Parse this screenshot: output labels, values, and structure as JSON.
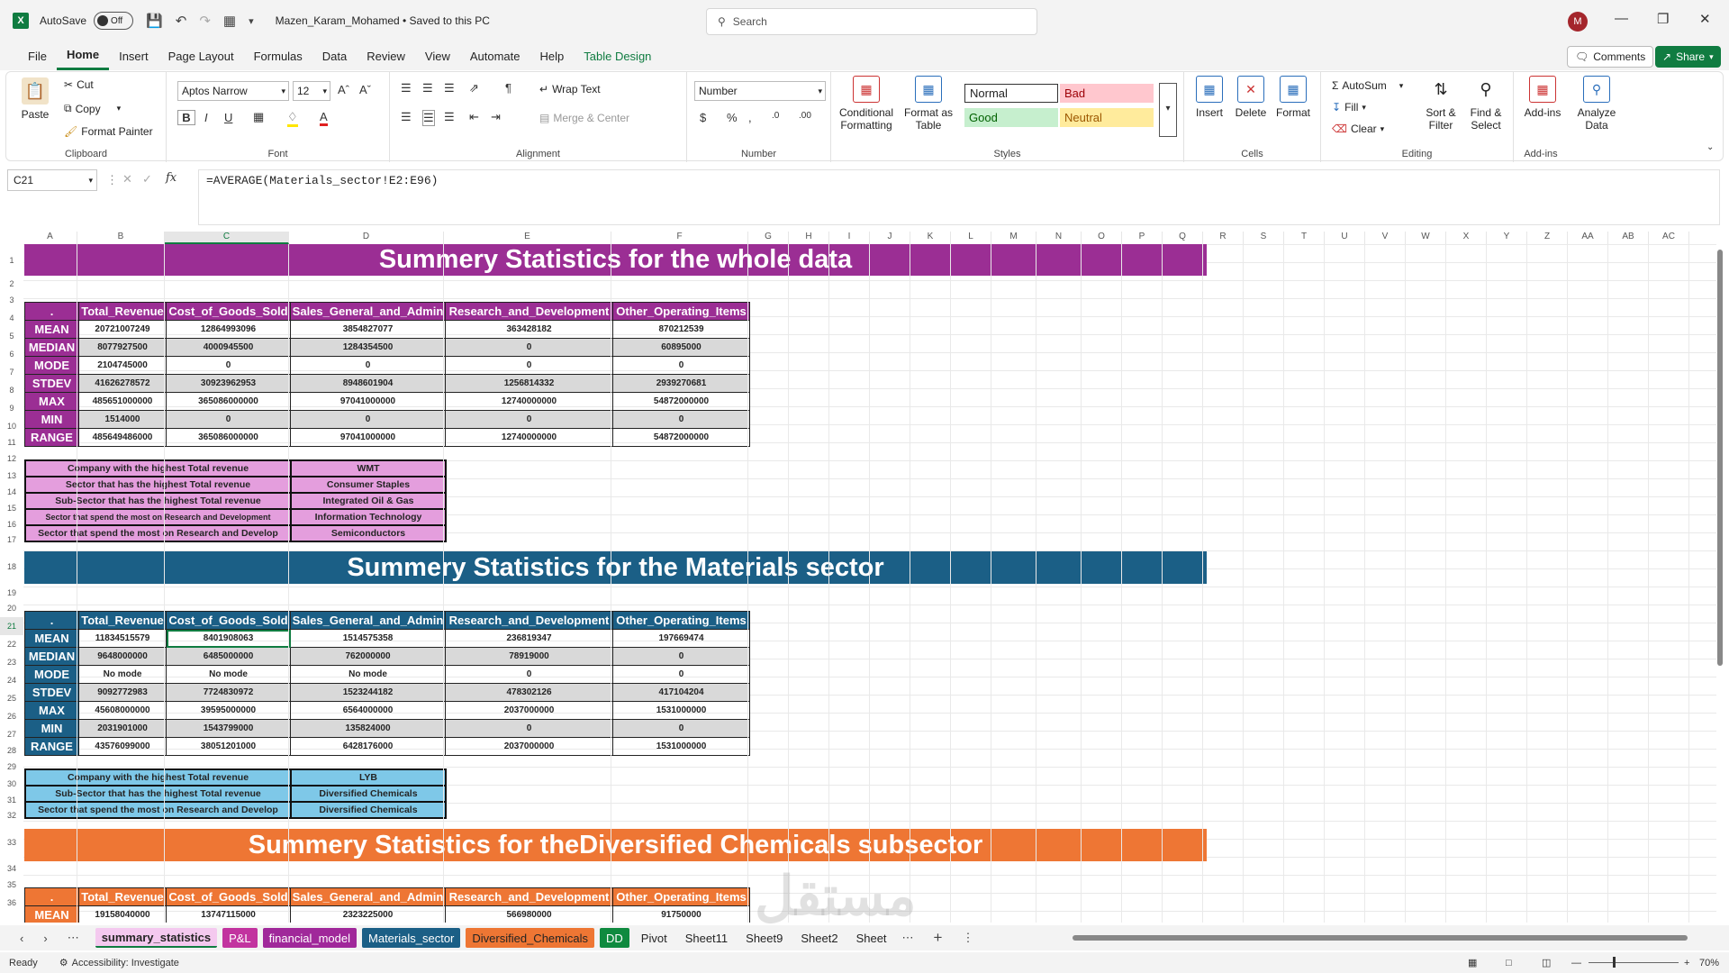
{
  "titlebar": {
    "autosave_label": "AutoSave",
    "autosave_state": "Off",
    "document_title": "Mazen_Karam_Mohamed • Saved to this PC",
    "search_placeholder": "Search",
    "avatar_initial": "M"
  },
  "menu": {
    "items": [
      "File",
      "Home",
      "Insert",
      "Page Layout",
      "Formulas",
      "Data",
      "Review",
      "View",
      "Automate",
      "Help",
      "Table Design"
    ],
    "active": "Home",
    "comments_label": "Comments",
    "share_label": "Share"
  },
  "ribbon": {
    "clipboard": {
      "label": "Clipboard",
      "paste": "Paste",
      "cut": "Cut",
      "copy": "Copy",
      "format_painter": "Format Painter"
    },
    "font": {
      "label": "Font",
      "name": "Aptos Narrow",
      "size": "12"
    },
    "alignment": {
      "label": "Alignment",
      "wrap_text": "Wrap Text",
      "merge_center": "Merge & Center"
    },
    "number": {
      "label": "Number",
      "format": "Number"
    },
    "styles": {
      "label": "Styles",
      "conditional_formatting": "Conditional Formatting",
      "format_as_table": "Format as Table",
      "normal": "Normal",
      "bad": "Bad",
      "good": "Good",
      "neutral": "Neutral"
    },
    "cells": {
      "label": "Cells",
      "insert": "Insert",
      "delete": "Delete",
      "format": "Format"
    },
    "editing": {
      "label": "Editing",
      "autosum": "AutoSum",
      "fill": "Fill",
      "clear": "Clear",
      "sort_filter": "Sort & Filter",
      "find_select": "Find & Select"
    },
    "addins": {
      "label": "Add-ins",
      "addins": "Add-ins",
      "analyze_data": "Analyze Data"
    }
  },
  "formula_bar": {
    "name_box": "C21",
    "formula": "=AVERAGE(Materials_sector!E2:E96)"
  },
  "columns": [
    "A",
    "B",
    "C",
    "D",
    "E",
    "F",
    "G",
    "H",
    "I",
    "J",
    "K",
    "L",
    "M",
    "N",
    "O",
    "P",
    "Q",
    "R",
    "S",
    "T",
    "U",
    "V",
    "W",
    "X",
    "Y",
    "Z",
    "AA",
    "AB",
    "AC"
  ],
  "rows": [
    "1",
    "2",
    "3",
    "4",
    "5",
    "6",
    "7",
    "8",
    "9",
    "10",
    "11",
    "12",
    "13",
    "14",
    "15",
    "16",
    "17",
    "18",
    "19",
    "20",
    "21",
    "22",
    "23",
    "24",
    "25",
    "26",
    "27",
    "28",
    "29",
    "30",
    "31",
    "32",
    "33",
    "34",
    "35",
    "36"
  ],
  "headers": [
    ".",
    "Total_Revenue",
    "Cost_of_Goods_Sold",
    "Sales_General_and_Admin",
    "Research_and_Development",
    "Other_Operating_Items"
  ],
  "section1": {
    "title": "Summery Statistics for the whole data",
    "rows": [
      {
        "label": "MEAN",
        "values": [
          "20721007249",
          "12864993096",
          "3854827077",
          "363428182",
          "870212539"
        ]
      },
      {
        "label": "MEDIAN",
        "values": [
          "8077927500",
          "4000945500",
          "1284354500",
          "0",
          "60895000"
        ]
      },
      {
        "label": "MODE",
        "values": [
          "2104745000",
          "0",
          "0",
          "0",
          "0"
        ]
      },
      {
        "label": "STDEV",
        "values": [
          "41626278572",
          "30923962953",
          "8948601904",
          "1256814332",
          "2939270681"
        ]
      },
      {
        "label": "MAX",
        "values": [
          "485651000000",
          "365086000000",
          "97041000000",
          "12740000000",
          "54872000000"
        ]
      },
      {
        "label": "MIN",
        "values": [
          "1514000",
          "0",
          "0",
          "0",
          "0"
        ]
      },
      {
        "label": "RANGE",
        "values": [
          "485649486000",
          "365086000000",
          "97041000000",
          "12740000000",
          "54872000000"
        ]
      }
    ],
    "info": [
      {
        "label": "Company with the highest Total revenue",
        "value": "WMT"
      },
      {
        "label": "Sector that has the highest Total revenue",
        "value": "Consumer Staples"
      },
      {
        "label": "Sub-Sector that has the highest Total revenue",
        "value": "Integrated Oil & Gas"
      },
      {
        "label": "Sector that spend the most on Research and Development",
        "value": "Information Technology"
      },
      {
        "label": "Sector that spend the most on Research and Develop",
        "value": "Semiconductors"
      }
    ]
  },
  "section2": {
    "title": "Summery Statistics for the Materials sector",
    "rows": [
      {
        "label": "MEAN",
        "values": [
          "11834515579",
          "8401908063",
          "1514575358",
          "236819347",
          "197669474"
        ]
      },
      {
        "label": "MEDIAN",
        "values": [
          "9648000000",
          "6485000000",
          "762000000",
          "78919000",
          "0"
        ]
      },
      {
        "label": "MODE",
        "values": [
          "No mode",
          "No mode",
          "No mode",
          "0",
          "0"
        ]
      },
      {
        "label": "STDEV",
        "values": [
          "9092772983",
          "7724830972",
          "1523244182",
          "478302126",
          "417104204"
        ]
      },
      {
        "label": "MAX",
        "values": [
          "45608000000",
          "39595000000",
          "6564000000",
          "2037000000",
          "1531000000"
        ]
      },
      {
        "label": "MIN",
        "values": [
          "2031901000",
          "1543799000",
          "135824000",
          "0",
          "0"
        ]
      },
      {
        "label": "RANGE",
        "values": [
          "43576099000",
          "38051201000",
          "6428176000",
          "2037000000",
          "1531000000"
        ]
      }
    ],
    "info": [
      {
        "label": "Company with the highest Total revenue",
        "value": "LYB"
      },
      {
        "label": "Sub-Sector that has the highest Total revenue",
        "value": "Diversified Chemicals"
      },
      {
        "label": "Sector that spend the most on Research and Develop",
        "value": "Diversified Chemicals"
      }
    ]
  },
  "section3": {
    "title": "Summery Statistics for theDiversified Chemicals subsector",
    "rows": [
      {
        "label": "MEAN",
        "values": [
          "19158040000",
          "13747115000",
          "2323225000",
          "566980000",
          "91750000"
        ]
      }
    ]
  },
  "colors": {
    "section1": "#9b2e94",
    "section1_info": "#e49edd",
    "section2": "#1b5f86",
    "section2_info": "#7ec8e8",
    "section3": "#ee7634",
    "excel_green": "#107c41"
  },
  "sheet_tabs": [
    {
      "label": "summary_statistics",
      "color": "#f4c9ef",
      "text": "#242424",
      "active": true
    },
    {
      "label": "P&L",
      "color": "#c2339f",
      "text": "#ffffff"
    },
    {
      "label": "financial_model",
      "color": "#a0289a",
      "text": "#ffffff"
    },
    {
      "label": "Materials_sector",
      "color": "#1b5f86",
      "text": "#ffffff"
    },
    {
      "label": "Diversified_Chemicals",
      "color": "#ee7634",
      "text": "#242424"
    },
    {
      "label": "DD",
      "color": "#0f8a3f",
      "text": "#ffffff"
    },
    {
      "label": "Pivot",
      "color": "",
      "text": "#242424"
    },
    {
      "label": "Sheet11",
      "color": "",
      "text": "#242424"
    },
    {
      "label": "Sheet9",
      "color": "",
      "text": "#242424"
    },
    {
      "label": "Sheet2",
      "color": "",
      "text": "#242424"
    },
    {
      "label": "Sheet",
      "color": "",
      "text": "#242424"
    }
  ],
  "status": {
    "ready": "Ready",
    "accessibility": "Accessibility: Investigate",
    "zoom": "70%"
  },
  "watermark": "مستقل"
}
